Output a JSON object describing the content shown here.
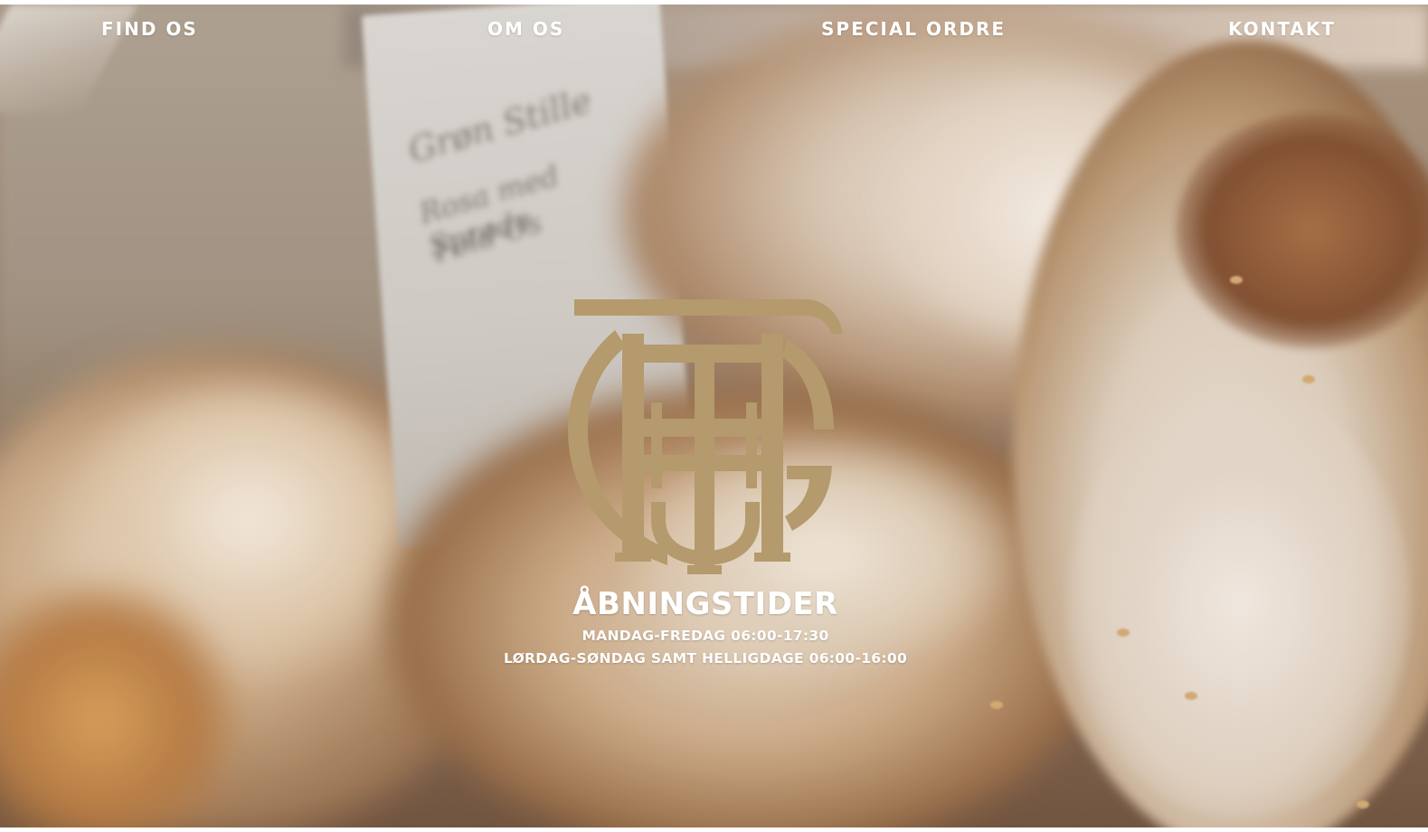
{
  "nav": {
    "items": [
      {
        "label": "FIND OS"
      },
      {
        "label": "OM OS"
      },
      {
        "label": "SPECIAL ORDRE"
      },
      {
        "label": "KONTAKT"
      }
    ]
  },
  "hero": {
    "logo_icon": "bakery-monogram-logo",
    "logo_color": "#b49a6c"
  },
  "opening_hours": {
    "title": "ÅBNINGSTIDER",
    "lines": [
      "MANDAG-FREDAG 06:00-17:30",
      "LØRDAG-SØNDAG SAMT HELLIGDAGE 06:00-16:00"
    ]
  },
  "colors": {
    "text": "#ffffff",
    "accent": "#b49a6c"
  }
}
